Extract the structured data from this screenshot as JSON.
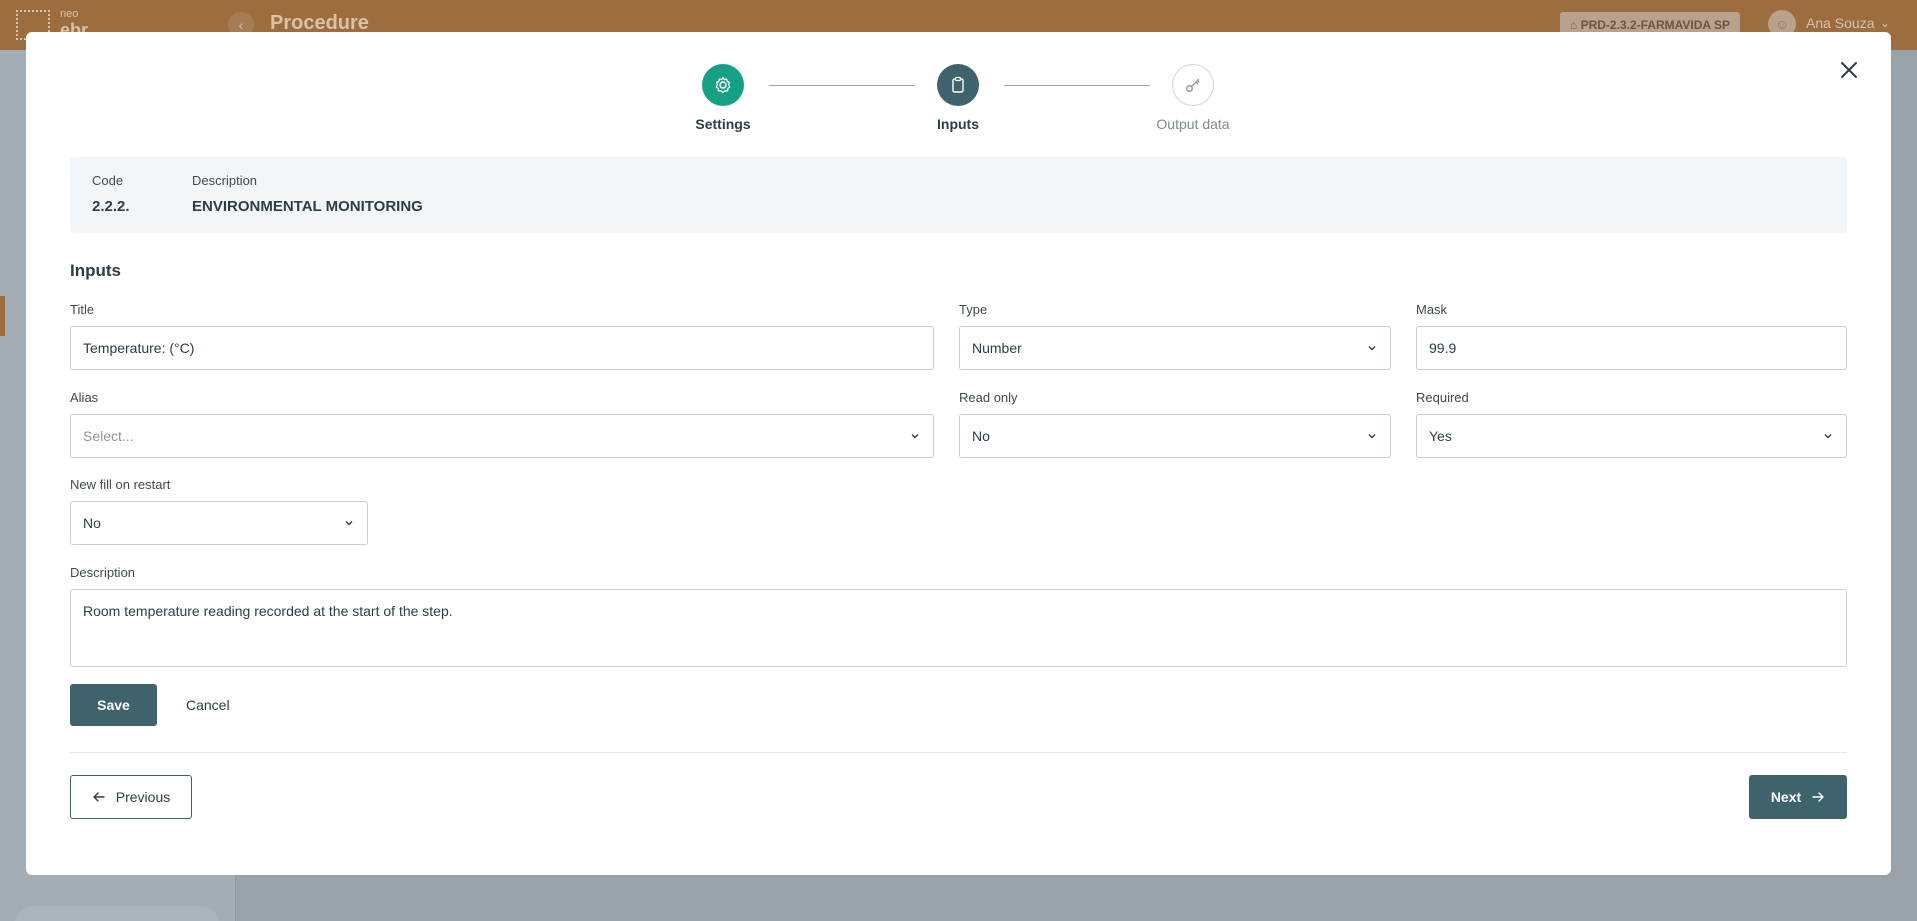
{
  "app": {
    "logo_top": "neo",
    "logo_bottom": "ebr",
    "page_title": "Procedure",
    "env_badge": "PRD-2.3.2-FARMAVIDA SP",
    "user_name": "Ana Souza",
    "header_color": "#9c6d3f"
  },
  "stepper": {
    "steps": [
      {
        "label": "Settings",
        "icon": "gear-icon",
        "state": "completed"
      },
      {
        "label": "Inputs",
        "icon": "clipboard-icon",
        "state": "active"
      },
      {
        "label": "Output data",
        "icon": "key-icon",
        "state": "pending"
      }
    ]
  },
  "info": {
    "code_label": "Code",
    "code_value": "2.2.2.",
    "description_label": "Description",
    "description_value": "ENVIRONMENTAL MONITORING"
  },
  "form": {
    "section_title": "Inputs",
    "title_label": "Title",
    "title_value": "Temperature: (°C)",
    "type_label": "Type",
    "type_value": "Number",
    "mask_label": "Mask",
    "mask_value": "99.9",
    "alias_label": "Alias",
    "alias_placeholder": "Select...",
    "read_only_label": "Read only",
    "read_only_value": "No",
    "required_label": "Required",
    "required_value": "Yes",
    "new_fill_label": "New fill on restart",
    "new_fill_value": "No",
    "description_label": "Description",
    "description_value": "Room temperature reading recorded at the start of the step.",
    "save_label": "Save",
    "cancel_label": "Cancel"
  },
  "nav": {
    "previous_label": "Previous",
    "next_label": "Next"
  },
  "colors": {
    "primary": "#3f636d",
    "success": "#16a085"
  }
}
